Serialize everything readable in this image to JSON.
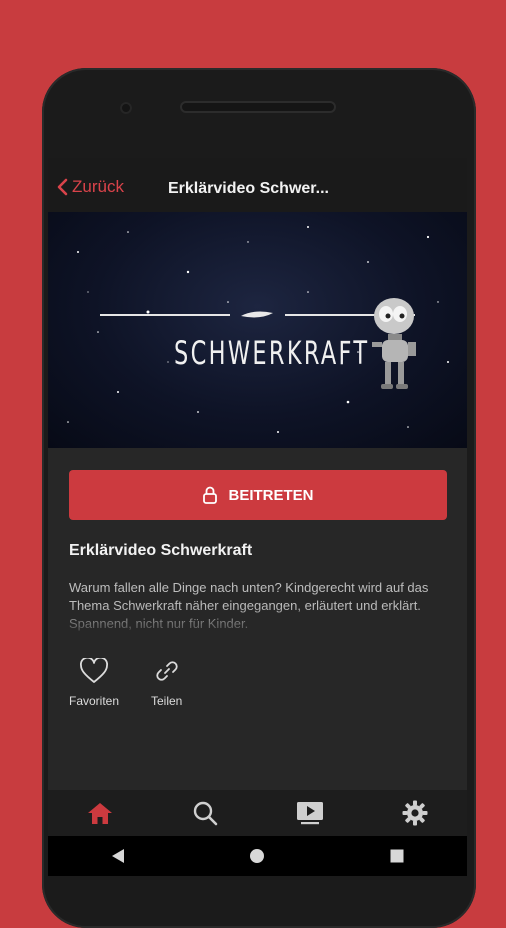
{
  "header": {
    "back_label": "Zurück",
    "title": "Erklärvideo Schwer..."
  },
  "hero": {
    "title": "SCHWERKRAFT"
  },
  "join_button": {
    "label": "BEITRETEN",
    "icon": "lock-icon"
  },
  "video": {
    "title": "Erklärvideo Schwerkraft",
    "description": "Warum fallen alle Dinge nach unten? Kindgerecht wird auf das Thema Schwerkraft näher eingegangen, erläutert und erklärt. Spannend, nicht nur für Kinder."
  },
  "actions": [
    {
      "label": "Favoriten",
      "icon": "heart-icon"
    },
    {
      "label": "Teilen",
      "icon": "link-icon"
    }
  ],
  "bottom_nav": [
    {
      "name": "home",
      "icon": "home-icon",
      "active": true
    },
    {
      "name": "search",
      "icon": "search-icon",
      "active": false
    },
    {
      "name": "videos",
      "icon": "video-icon",
      "active": false
    },
    {
      "name": "settings",
      "icon": "gear-icon",
      "active": false
    }
  ],
  "system_nav": [
    "back-triangle-icon",
    "home-circle-icon",
    "recents-square-icon"
  ],
  "colors": {
    "accent": "#cc3a3f",
    "background": "#c83c3f",
    "screen": "#272727",
    "text": "#f2f2f2"
  }
}
